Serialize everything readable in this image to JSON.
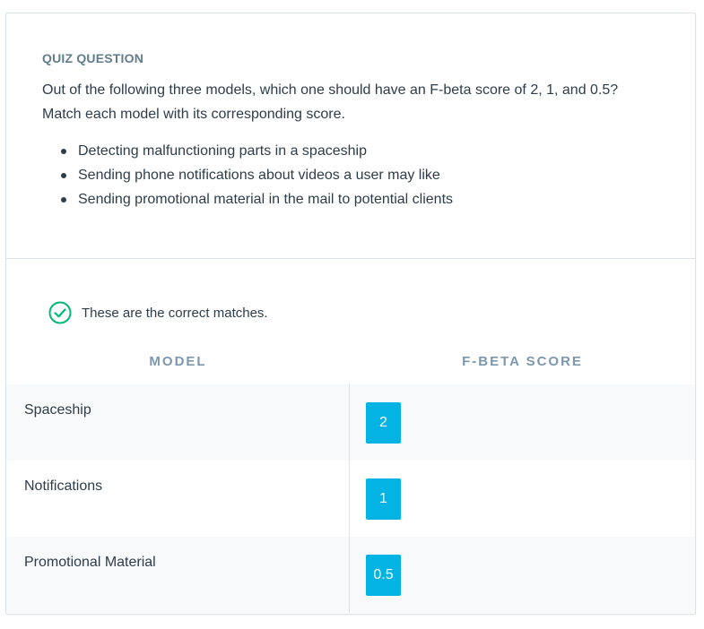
{
  "quiz": {
    "label": "QUIZ QUESTION",
    "question_line1": "Out of the following three models, which one should have an F-beta score of 2, 1, and 0.5?",
    "question_line2": "Match each model with its corresponding score.",
    "items": [
      "Detecting malfunctioning parts in a spaceship",
      "Sending phone notifications about videos a user may like",
      "Sending promotional material in the mail to potential clients"
    ]
  },
  "feedback": {
    "icon": "check-circle-icon",
    "text": "These are the correct matches.",
    "color": "#02b875"
  },
  "table": {
    "headers": [
      "MODEL",
      "F-BETA SCORE"
    ],
    "rows": [
      {
        "model": "Spaceship",
        "score": "2"
      },
      {
        "model": "Notifications",
        "score": "1"
      },
      {
        "model": "Promotional Material",
        "score": "0.5"
      }
    ]
  },
  "colors": {
    "accent": "#02b3e4",
    "header_text": "#7d97ad",
    "text": "#2e3d49"
  }
}
